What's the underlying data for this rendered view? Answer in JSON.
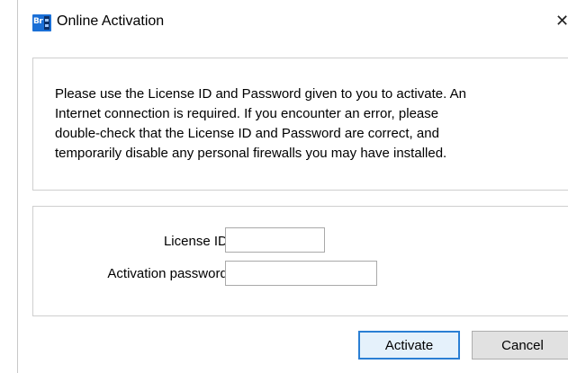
{
  "window": {
    "title": "Online Activation",
    "close_glyph": "✕",
    "app_icon": {
      "name": "br-app-icon",
      "text": "Br",
      "accent_color": "#1a6fd6"
    }
  },
  "info": {
    "lines": [
      "Please use the License ID and Password given to you to activate.  An",
      "Internet connection is required.  If you encounter an error, please",
      "double-check that the License ID and Password are correct, and",
      "temporarily disable any personal firewalls you may have installed."
    ]
  },
  "form": {
    "license_id_label": "License ID:",
    "license_id_value": "",
    "activation_password_label": "Activation password:",
    "activation_password_value": ""
  },
  "buttons": {
    "activate_label": "Activate",
    "cancel_label": "Cancel",
    "default_button_border_color": "#2a7fd4"
  }
}
